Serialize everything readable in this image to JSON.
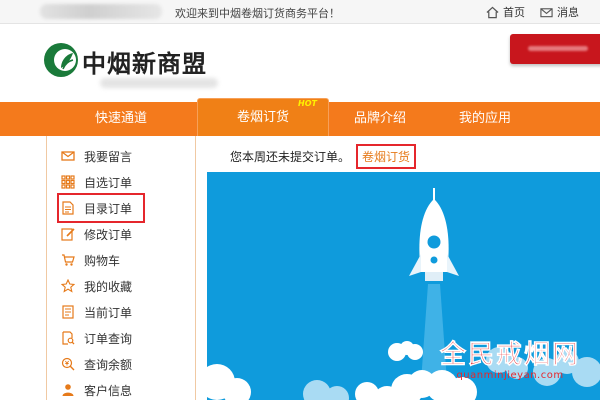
{
  "topbar": {
    "welcome": "欢迎来到中烟卷烟订货商务平台！",
    "home_label": "首页",
    "messages_label": "消息",
    "home_icon": "home-icon",
    "messages_icon": "mail-icon"
  },
  "header": {
    "logo_text": "中烟新商盟",
    "brand_color": "#1a7a3a",
    "accent_red": "#c8161d"
  },
  "nav": {
    "quick_label": "快速通道",
    "order_tab_label": "卷烟订货",
    "hot_badge": "HOT",
    "brand_label": "品牌介绍",
    "apps_label": "我的应用",
    "color": "#f47a1c"
  },
  "sidebar": {
    "items": [
      {
        "label": "我要留言",
        "icon": "message-icon"
      },
      {
        "label": "自选订单",
        "icon": "grid-icon"
      },
      {
        "label": "目录订单",
        "icon": "document-icon"
      },
      {
        "label": "修改订单",
        "icon": "edit-icon"
      },
      {
        "label": "购物车",
        "icon": "cart-icon"
      },
      {
        "label": "我的收藏",
        "icon": "star-icon"
      },
      {
        "label": "当前订单",
        "icon": "list-icon"
      },
      {
        "label": "订单查询",
        "icon": "file-search-icon"
      },
      {
        "label": "查询余额",
        "icon": "balance-search-icon"
      },
      {
        "label": "客户信息",
        "icon": "user-icon"
      }
    ]
  },
  "content": {
    "notice_text": "您本周还未提交订单。",
    "order_link": "卷烟订货",
    "hero_color": "#0f9bdc"
  },
  "watermark": {
    "title": "全民戒烟网",
    "url": "quanminjieyan.com"
  }
}
